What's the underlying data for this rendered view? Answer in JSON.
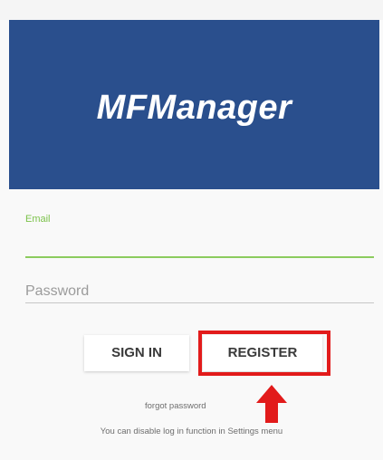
{
  "app": {
    "title": "MFManager",
    "header_color": "#2a4f8d"
  },
  "form": {
    "email_label": "Email",
    "email_value": "",
    "email_accent": "#8ccc5e",
    "password_placeholder": "Password"
  },
  "buttons": {
    "sign_in": "SIGN IN",
    "register": "REGISTER"
  },
  "annotation": {
    "highlight_color": "#e21b1b",
    "arrow_icon": "up-arrow"
  },
  "links": {
    "forgot_password": "forgot password"
  },
  "footer": {
    "note": "You can disable log in function in Settings menu"
  }
}
